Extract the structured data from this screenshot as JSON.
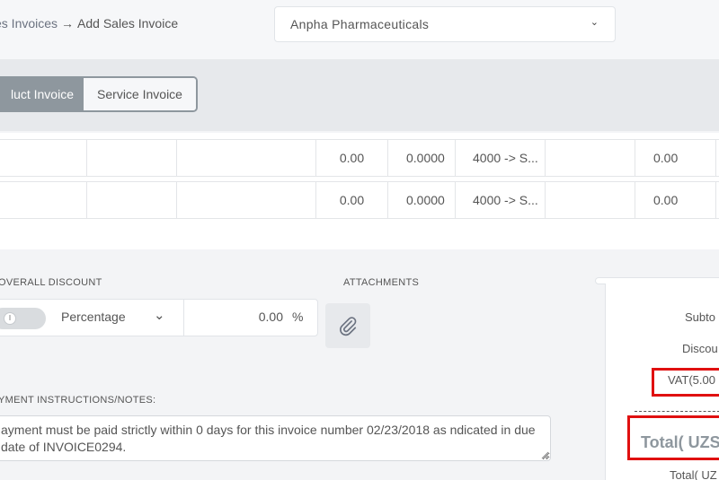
{
  "breadcrumb": {
    "parent": "es Invoices",
    "separator": "→",
    "current": "Add Sales Invoice"
  },
  "company_select": {
    "value": "Anpha Pharmaceuticals",
    "chevron": "chevron-down-icon"
  },
  "invoice_type_tabs": [
    {
      "label": "luct Invoice",
      "active": true
    },
    {
      "label": "Service Invoice",
      "active": false
    }
  ],
  "line_items": [
    {
      "qty": "0.00",
      "rate": "0.0000",
      "account": "4000 -> S...",
      "amount": "0.00"
    },
    {
      "qty": "0.00",
      "rate": "0.0000",
      "account": "4000 -> S...",
      "amount": "0.00"
    }
  ],
  "overall_discount": {
    "label": "OVERALL DISCOUNT",
    "type": "Percentage",
    "value": "0.00",
    "unit": "%"
  },
  "attachments": {
    "label": "ATTACHMENTS",
    "icon": "paperclip-icon"
  },
  "notes": {
    "label": "YMENT INSTRUCTIONS/NOTES:",
    "text": "ayment must be paid strictly within 0 days for this invoice number 02/23/2018 as ndicated in due date of INVOICE0294."
  },
  "summary": {
    "subtotal_label": "Subto",
    "discount_label": "Discou",
    "vat_label": "VAT(5.00",
    "total_label": "Total( UZS",
    "total_bottom_label": "Total( UZ"
  },
  "colors": {
    "accent": "#8e979e",
    "highlight": "#e01010"
  }
}
